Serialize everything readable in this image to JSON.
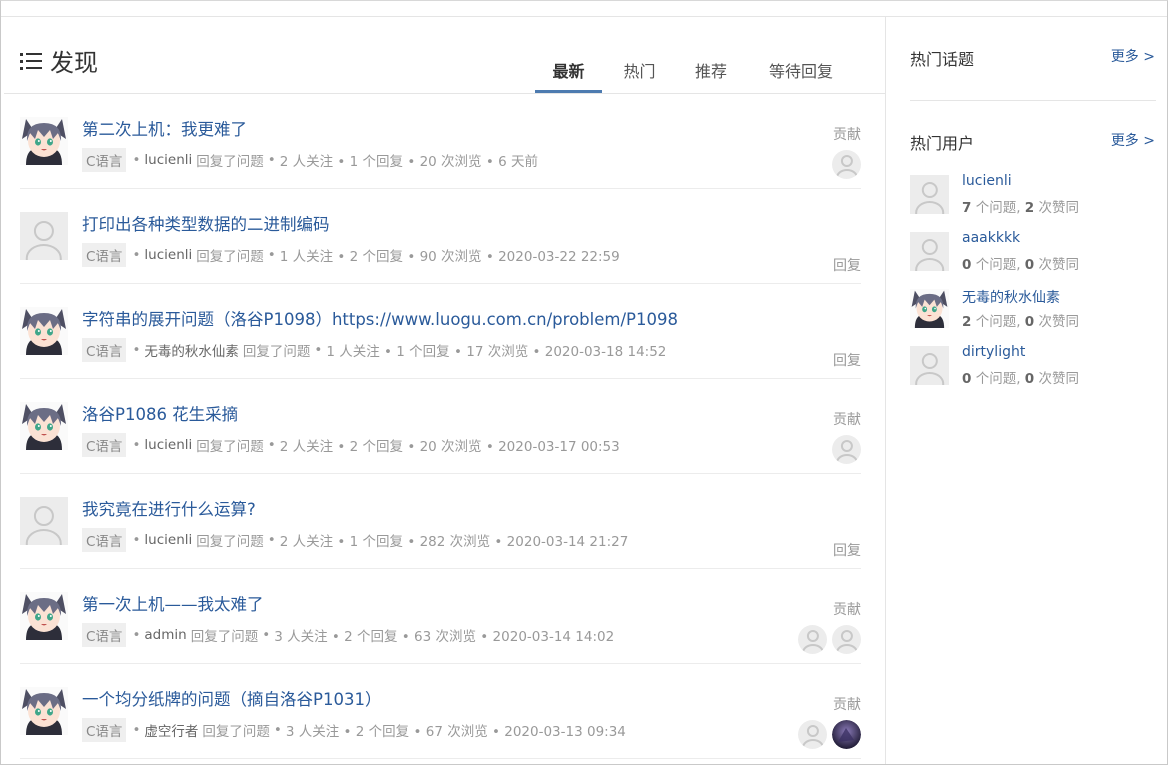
{
  "page": {
    "title": "发现"
  },
  "tabs": [
    "最新",
    "热门",
    "推荐",
    "等待回复"
  ],
  "questions": [
    {
      "title": "第二次上机：我更难了",
      "tag": "C语言",
      "user": "lucienli",
      "action": "回复了问题",
      "stats": "2 人关注 • 1 个回复 • 20 次浏览 • 6 天前",
      "right_label": "贡献",
      "avatar": "anime",
      "contributors": [
        "placeholder"
      ]
    },
    {
      "title": "打印出各种类型数据的二进制编码",
      "tag": "C语言",
      "user": "lucienli",
      "action": "回复了问题",
      "stats": "1 人关注 • 2 个回复 • 90 次浏览 • 2020-03-22 22:59",
      "right_label": "回复",
      "avatar": "placeholder",
      "contributors": []
    },
    {
      "title": "字符串的展开问题（洛谷P1098）https://www.luogu.com.cn/problem/P1098",
      "tag": "C语言",
      "user": "无毒的秋水仙素",
      "action": "回复了问题",
      "stats": "1 人关注 • 1 个回复 • 17 次浏览 • 2020-03-18 14:52",
      "right_label": "回复",
      "avatar": "anime",
      "contributors": []
    },
    {
      "title": "洛谷P1086 花生采摘",
      "tag": "C语言",
      "user": "lucienli",
      "action": "回复了问题",
      "stats": "2 人关注 • 2 个回复 • 20 次浏览 • 2020-03-17 00:53",
      "right_label": "贡献",
      "avatar": "anime",
      "contributors": [
        "placeholder"
      ]
    },
    {
      "title": "我究竟在进行什么运算?",
      "tag": "C语言",
      "user": "lucienli",
      "action": "回复了问题",
      "stats": "2 人关注 • 1 个回复 • 282 次浏览 • 2020-03-14 21:27",
      "right_label": "回复",
      "avatar": "placeholder",
      "contributors": []
    },
    {
      "title": "第一次上机——我太难了",
      "tag": "C语言",
      "user": "admin",
      "action": "回复了问题",
      "stats": "3 人关注 • 2 个回复 • 63 次浏览 • 2020-03-14 14:02",
      "right_label": "贡献",
      "avatar": "anime",
      "contributors": [
        "placeholder",
        "placeholder"
      ]
    },
    {
      "title": "一个均分纸牌的问题（摘自洛谷P1031）",
      "tag": "C语言",
      "user": "虚空行者",
      "action": "回复了问题",
      "stats": "3 人关注 • 2 个回复 • 67 次浏览 • 2020-03-13 09:34",
      "right_label": "贡献",
      "avatar": "anime",
      "contributors": [
        "placeholder",
        "dark"
      ]
    }
  ],
  "sidebar": {
    "hot_topics": {
      "title": "热门话题",
      "more": "更多 >"
    },
    "hot_users": {
      "title": "热门用户",
      "more": "更多 >"
    },
    "users": [
      {
        "name": "lucienli",
        "questions": "7",
        "q_label": " 个问题, ",
        "likes": "2",
        "l_label": " 次赞同",
        "avatar": "placeholder"
      },
      {
        "name": "aaakkkk",
        "questions": "0",
        "q_label": " 个问题, ",
        "likes": "0",
        "l_label": " 次赞同",
        "avatar": "placeholder"
      },
      {
        "name": "无毒的秋水仙素",
        "questions": "2",
        "q_label": " 个问题, ",
        "likes": "0",
        "l_label": " 次赞同",
        "avatar": "anime"
      },
      {
        "name": "dirtylight",
        "questions": "0",
        "q_label": " 个问题, ",
        "likes": "0",
        "l_label": " 次赞同",
        "avatar": "placeholder"
      }
    ]
  },
  "colors": {
    "link": "#2a5a9a",
    "accent": "#4d7bb0",
    "muted": "#999999"
  },
  "icons": {
    "title_icon": "list-icon",
    "avatar_placeholder": "user-silhouette-icon"
  }
}
